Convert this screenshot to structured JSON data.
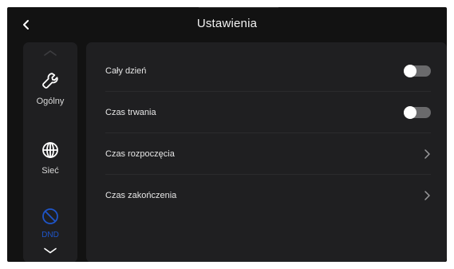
{
  "header": {
    "title": "Ustawienia",
    "back_icon": "chevron-left-icon"
  },
  "sidebar": {
    "scroll_up_icon": "chevron-up-icon",
    "scroll_down_icon": "chevron-down-icon",
    "items": [
      {
        "label": "Ogólny",
        "icon": "wrench-icon",
        "active": false
      },
      {
        "label": "Sieć",
        "icon": "globe-icon",
        "active": false
      },
      {
        "label": "DND",
        "icon": "do-not-disturb-icon",
        "active": true
      }
    ]
  },
  "settings": {
    "rows": [
      {
        "label": "Cały dzień",
        "control": "toggle",
        "on": false
      },
      {
        "label": "Czas trwania",
        "control": "toggle",
        "on": false
      },
      {
        "label": "Czas rozpoczęcia",
        "control": "chevron-right-icon"
      },
      {
        "label": "Czas zakończenia",
        "control": "chevron-right-icon"
      }
    ]
  },
  "colors": {
    "background": "#121212",
    "panel": "#1f1f21",
    "accent": "#1f55c9",
    "toggle_off": "#6a6a6c",
    "text": "#e6e6e6"
  }
}
